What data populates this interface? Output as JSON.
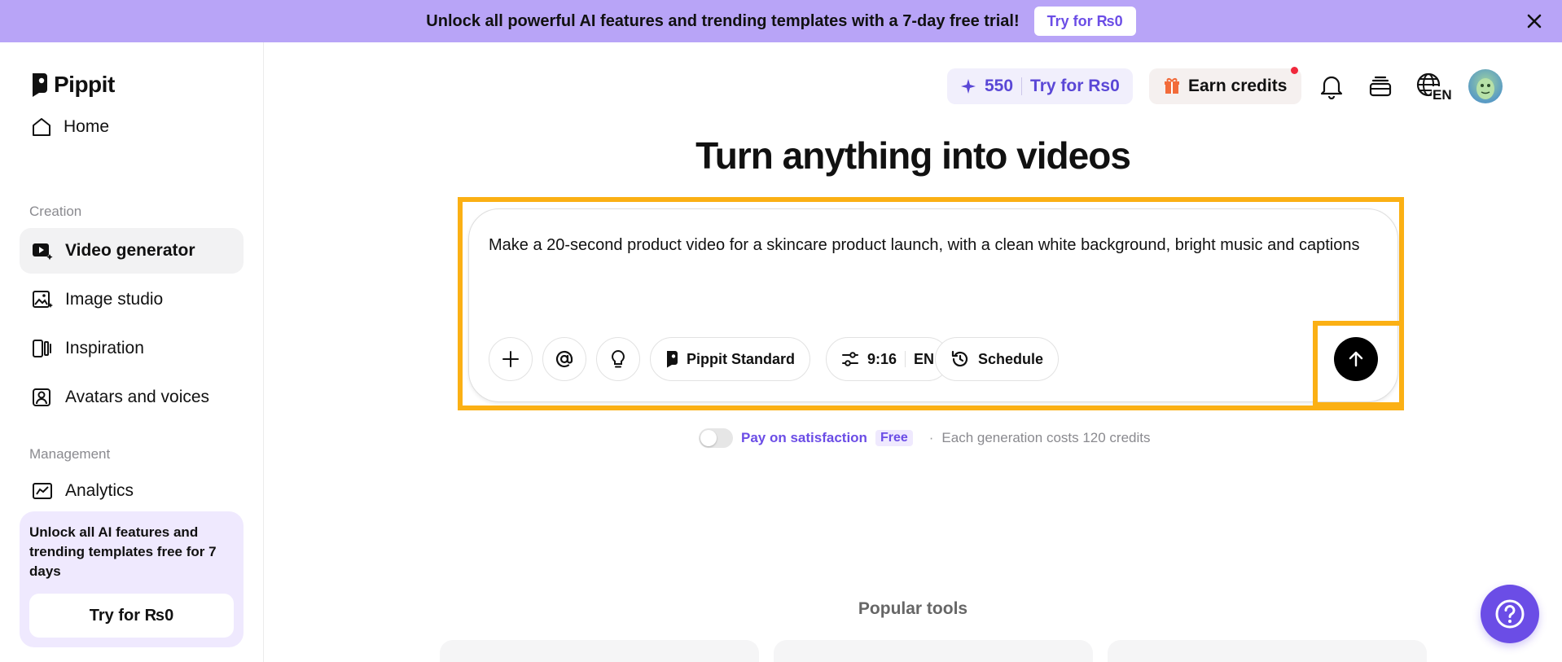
{
  "banner": {
    "text": "Unlock all powerful AI features and trending templates with a 7-day free trial!",
    "cta": "Try for ₨0"
  },
  "sidebar": {
    "logo": "Pippit",
    "items": [
      {
        "label": "Home",
        "icon": "home-icon"
      },
      {
        "label": "Video generator",
        "icon": "video-generator-icon",
        "active": true
      },
      {
        "label": "Image studio",
        "icon": "image-studio-icon"
      },
      {
        "label": "Inspiration",
        "icon": "inspiration-icon"
      },
      {
        "label": "Avatars and voices",
        "icon": "avatar-icon"
      },
      {
        "label": "Analytics",
        "icon": "analytics-icon"
      }
    ],
    "sections": {
      "creation": "Creation",
      "management": "Management"
    },
    "promo": {
      "text": "Unlock all AI features and trending templates free for 7 days",
      "cta": "Try for ₨0"
    }
  },
  "header": {
    "credits": "550",
    "try_label": "Try for Rs0",
    "earn_label": "Earn credits",
    "language": "EN"
  },
  "main": {
    "title": "Turn anything into videos",
    "prompt": "Make a 20-second product video for a skincare product launch, with a clean white background, bright music and captions",
    "toolbar": {
      "model": "Pippit Standard",
      "ratio": "9:16",
      "language": "EN",
      "schedule": "Schedule"
    },
    "satisfaction": {
      "label": "Pay on satisfaction",
      "badge": "Free",
      "separator": "·",
      "cost": "Each generation costs 120 credits"
    },
    "popular_title": "Popular tools"
  },
  "colors": {
    "accent": "#6b4de6",
    "banner": "#b8a4f7",
    "highlight": "#fbb014"
  }
}
